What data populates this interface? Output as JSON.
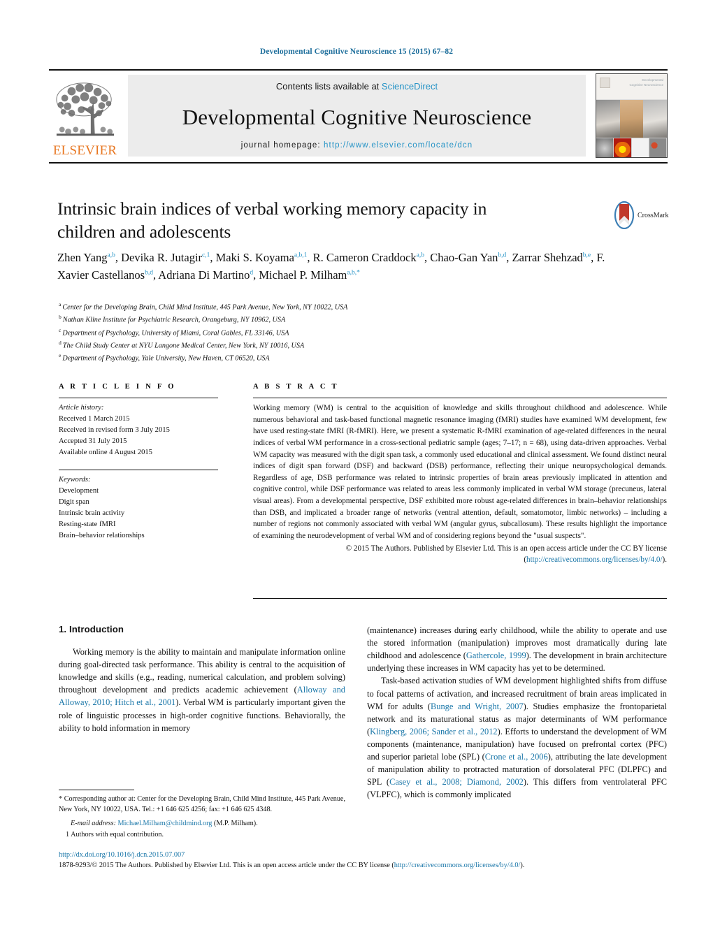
{
  "running_head": "Developmental Cognitive Neuroscience 15 (2015) 67–82",
  "masthead": {
    "contents_prefix": "Contents lists available at ",
    "sciencedirect": "ScienceDirect",
    "journal_title": "Developmental Cognitive Neuroscience",
    "homepage_label": "journal homepage: ",
    "homepage_url": "http://www.elsevier.com/locate/dcn",
    "publisher": "ELSEVIER",
    "cover_title_line1": "Developmental",
    "cover_title_line2": "Cognitive Neuroscience"
  },
  "article": {
    "title": "Intrinsic brain indices of verbal working memory capacity in children and adolescents",
    "crossmark_label": "CrossMark",
    "authors_html": "Zhen Yang<sup>a,b</sup>, Devika R. Jutagir<sup>c,1</sup>, Maki S. Koyama<sup>a,b,1</sup>, R. Cameron Craddock<sup>a,b</sup>, Chao-Gan Yan<sup>b,d</sup>, Zarrar Shehzad<sup>b,e</sup>, F. Xavier Castellanos<sup>b,d</sup>, Adriana Di Martino<sup>d</sup>, Michael P. Milham<sup>a,b,*</sup>",
    "affiliations": [
      {
        "label": "a",
        "text": "Center for the Developing Brain, Child Mind Institute, 445 Park Avenue, New York, NY 10022, USA"
      },
      {
        "label": "b",
        "text": "Nathan Kline Institute for Psychiatric Research, Orangeburg, NY 10962, USA"
      },
      {
        "label": "c",
        "text": "Department of Psychology, University of Miami, Coral Gables, FL 33146, USA"
      },
      {
        "label": "d",
        "text": "The Child Study Center at NYU Langone Medical Center, New York, NY 10016, USA"
      },
      {
        "label": "e",
        "text": "Department of Psychology, Yale University, New Haven, CT 06520, USA"
      }
    ]
  },
  "article_info": {
    "heading": "A R T I C L E   I N F O",
    "history_label": "Article history:",
    "history": [
      "Received 1 March 2015",
      "Received in revised form 3 July 2015",
      "Accepted 31 July 2015",
      "Available online 4 August 2015"
    ],
    "keywords_label": "Keywords:",
    "keywords": [
      "Development",
      "Digit span",
      "Intrinsic brain activity",
      "Resting-state fMRI",
      "Brain–behavior relationships"
    ]
  },
  "abstract": {
    "heading": "A B S T R A C T",
    "text": "Working memory (WM) is central to the acquisition of knowledge and skills throughout childhood and adolescence. While numerous behavioral and task-based functional magnetic resonance imaging (fMRI) studies have examined WM development, few have used resting-state fMRI (R-fMRI). Here, we present a systematic R-fMRI examination of age-related differences in the neural indices of verbal WM performance in a cross-sectional pediatric sample (ages; 7–17; n = 68), using data-driven approaches. Verbal WM capacity was measured with the digit span task, a commonly used educational and clinical assessment. We found distinct neural indices of digit span forward (DSF) and backward (DSB) performance, reflecting their unique neuropsychological demands. Regardless of age, DSB performance was related to intrinsic properties of brain areas previously implicated in attention and cognitive control, while DSF performance was related to areas less commonly implicated in verbal WM storage (precuneus, lateral visual areas). From a developmental perspective, DSF exhibited more robust age-related differences in brain–behavior relationships than DSB, and implicated a broader range of networks (ventral attention, default, somatomotor, limbic networks) – including a number of regions not commonly associated with verbal WM (angular gyrus, subcallosum). These results highlight the importance of examining the neurodevelopment of verbal WM and of considering regions beyond the \"usual suspects\".",
    "copyright": "© 2015 The Authors. Published by Elsevier Ltd. This is an open access article under the CC BY license",
    "license_open": "(",
    "license_url": "http://creativecommons.org/licenses/by/4.0/",
    "license_close": ")."
  },
  "body": {
    "section_number_title": "1.  Introduction",
    "left_paragraphs": [
      {
        "segments": [
          {
            "type": "text",
            "value": "Working memory is the ability to maintain and manipulate information online during goal-directed task performance. This ability is central to the acquisition of knowledge and skills (e.g., reading, numerical calculation, and problem solving) throughout development and predicts academic achievement ("
          },
          {
            "type": "link",
            "value": "Alloway and Alloway, 2010; Hitch et al., 2001"
          },
          {
            "type": "text",
            "value": "). Verbal WM is particularly important given the role of linguistic processes in high-order cognitive functions. Behaviorally, the ability to hold information in memory"
          }
        ]
      }
    ],
    "right_paragraphs": [
      {
        "indent": false,
        "segments": [
          {
            "type": "text",
            "value": "(maintenance) increases during early childhood, while the ability to operate and use the stored information (manipulation) improves most dramatically during late childhood and adolescence ("
          },
          {
            "type": "link",
            "value": "Gathercole, 1999"
          },
          {
            "type": "text",
            "value": "). The development in brain architecture underlying these increases in WM capacity has yet to be determined."
          }
        ]
      },
      {
        "indent": true,
        "segments": [
          {
            "type": "text",
            "value": "Task-based activation studies of WM development highlighted shifts from diffuse to focal patterns of activation, and increased recruitment of brain areas implicated in WM for adults ("
          },
          {
            "type": "link",
            "value": "Bunge and Wright, 2007"
          },
          {
            "type": "text",
            "value": "). Studies emphasize the frontoparietal network and its maturational status as major determinants of WM performance ("
          },
          {
            "type": "link",
            "value": "Klingberg, 2006; Sander et al., 2012"
          },
          {
            "type": "text",
            "value": "). Efforts to understand the development of WM components (maintenance, manipulation) have focused on prefrontal cortex (PFC) and superior parietal lobe (SPL) ("
          },
          {
            "type": "link",
            "value": "Crone et al., 2006"
          },
          {
            "type": "text",
            "value": "), attributing the late development of manipulation ability to protracted maturation of dorsolateral PFC (DLPFC) and SPL ("
          },
          {
            "type": "link",
            "value": "Casey et al., 2008; Diamond, 2002"
          },
          {
            "type": "text",
            "value": "). This differs from ventrolateral PFC (VLPFC), which is commonly implicated"
          }
        ]
      }
    ]
  },
  "footnotes": {
    "corresponding": "*  Corresponding author at: Center for the Developing Brain, Child Mind Institute, 445 Park Avenue, New York, NY 10022, USA. Tel.: +1 646 625 4256; fax: +1 646 625 4348.",
    "email_label": "E-mail address:",
    "email_link": "Michael.Milham@childmind.org",
    "email_suffix": " (M.P. Milham).",
    "equal_contribution": "1  Authors with equal contribution."
  },
  "footer": {
    "doi": "http://dx.doi.org/10.1016/j.dcn.2015.07.007",
    "copyright_prefix": "1878-9293/© 2015 The Authors. Published by Elsevier Ltd. This is an open access article under the CC BY license (",
    "license_url": "http://creativecommons.org/licenses/by/4.0/",
    "copyright_suffix": ")."
  },
  "colors": {
    "link": "#1976a8",
    "running_head": "#1f6f9c",
    "elsevier_orange": "#E87722",
    "sciencedirect": "#2593c6"
  }
}
